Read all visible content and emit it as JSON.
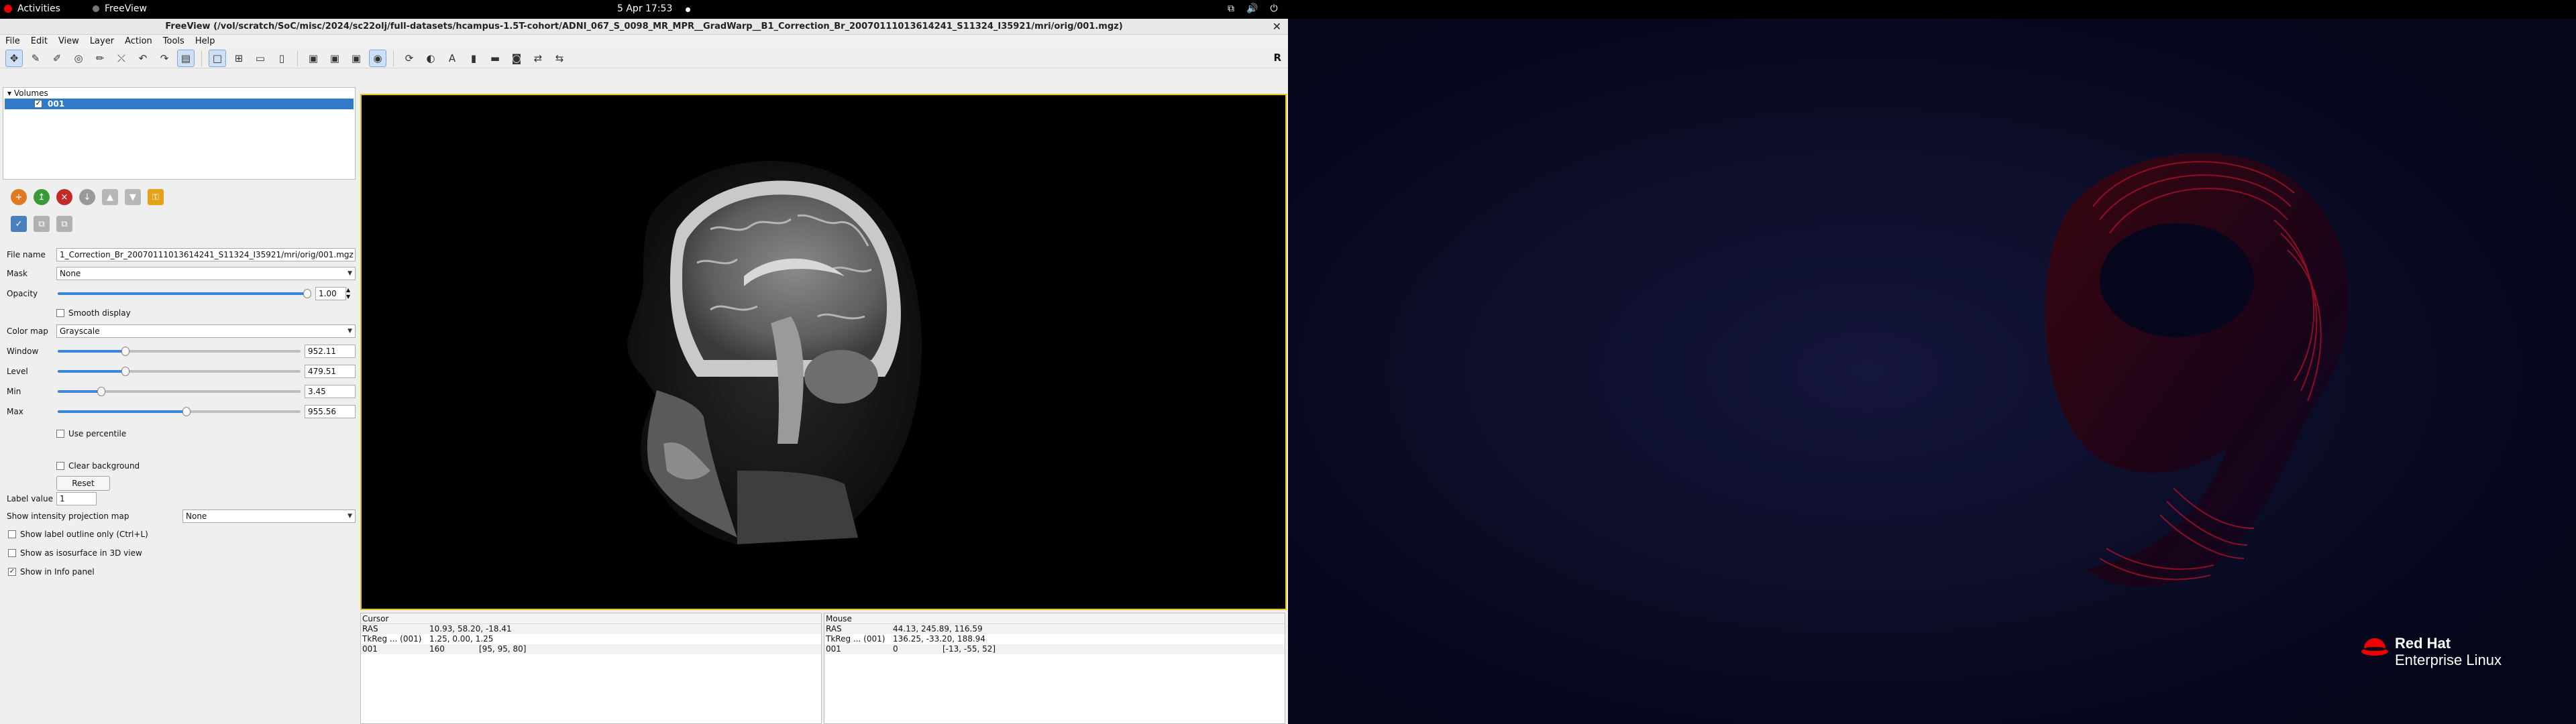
{
  "topbar": {
    "activities": "Activities",
    "app": "FreeView",
    "clock": "5 Apr  17:53"
  },
  "window": {
    "title": "FreeView (/vol/scratch/SoC/misc/2024/sc22olj/full-datasets/hcampus-1.5T-cohort/ADNI_067_S_0098_MR_MPR__GradWarp__B1_Correction_Br_20070111013614241_S11324_I35921/mri/orig/001.mgz)",
    "close": "✕"
  },
  "menu": [
    "File",
    "Edit",
    "View",
    "Layer",
    "Action",
    "Tools",
    "Help"
  ],
  "toolbar": {
    "view_label": "R"
  },
  "layers": {
    "group": "Volumes",
    "volume_name": "001",
    "volume_checked": true
  },
  "props": {
    "file_name_label": "File name",
    "file_name_value": "1_Correction_Br_20070111013614241_S11324_I35921/mri/orig/001.mgz",
    "mask_label": "Mask",
    "mask_value": "None",
    "opacity_label": "Opacity",
    "opacity_value": "1.00",
    "opacity_fraction": 1.0,
    "smooth_label": "Smooth display",
    "colormap_label": "Color map",
    "colormap_value": "Grayscale",
    "window_label": "Window",
    "window_value": "952.11",
    "window_fraction": 0.28,
    "level_label": "Level",
    "level_value": "479.51",
    "level_fraction": 0.28,
    "min_label": "Min",
    "min_value": "3.45",
    "min_fraction": 0.18,
    "max_label": "Max",
    "max_value": "955.56",
    "max_fraction": 0.53,
    "use_percentile_label": "Use percentile",
    "clear_bg_label": "Clear background",
    "reset_label": "Reset",
    "label_value_label": "Label value",
    "label_value_value": "1",
    "intensity_proj_label": "Show intensity projection map",
    "intensity_proj_value": "None",
    "label_outline_label": "Show label outline only (Ctrl+L)",
    "isosurface_label": "Show as isosurface in 3D view",
    "info_panel_label": "Show in Info panel",
    "info_panel_checked": true
  },
  "info": {
    "cursor": {
      "title": "Cursor",
      "rows": [
        {
          "name": "RAS",
          "v1": "10.93, 58.20, -18.41",
          "v2": ""
        },
        {
          "name": "TkReg ... (001)",
          "v1": "1.25, 0.00, 1.25",
          "v2": ""
        },
        {
          "name": "001",
          "v1": "160",
          "v2": "[95, 95, 80]"
        }
      ]
    },
    "mouse": {
      "title": "Mouse",
      "rows": [
        {
          "name": "RAS",
          "v1": "44.13, 245.89, 116.59",
          "v2": ""
        },
        {
          "name": "TkReg ... (001)",
          "v1": "136.25, -33.20, 188.94",
          "v2": ""
        },
        {
          "name": "001",
          "v1": "0",
          "v2": "[-13, -55, 52]"
        }
      ]
    }
  },
  "desktop": {
    "brand_line1": "Red Hat",
    "brand_line2": "Enterprise Linux"
  },
  "colors": {
    "accent": "#2f7bc9",
    "view_border": "#e5c417",
    "brand_red": "#ee0000"
  }
}
